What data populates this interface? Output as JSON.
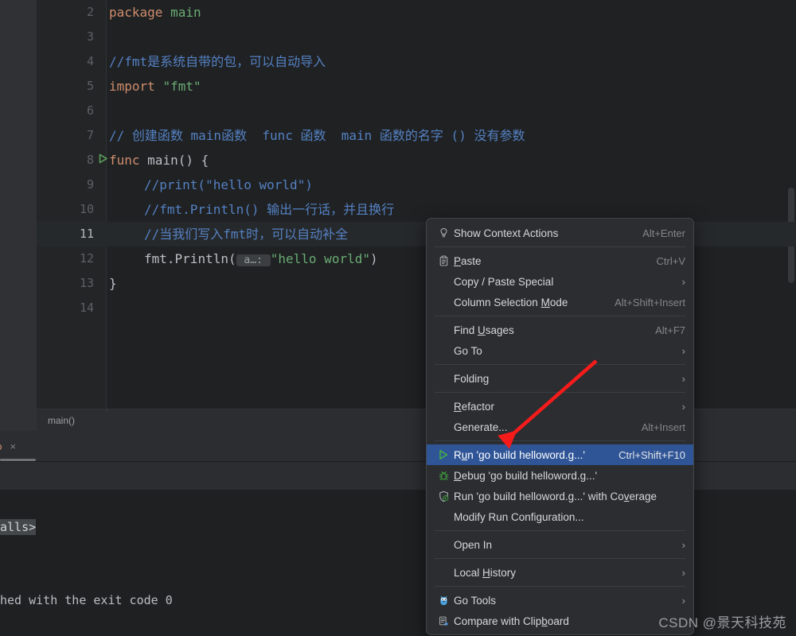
{
  "editor": {
    "lines": [
      {
        "num": "2",
        "indent": 0,
        "tokens": [
          {
            "t": "package ",
            "c": "kw"
          },
          {
            "t": "main",
            "c": "str"
          }
        ]
      },
      {
        "num": "3",
        "indent": 0,
        "tokens": []
      },
      {
        "num": "4",
        "indent": 0,
        "tokens": [
          {
            "t": "//fmt是系统自带的包，可以自动导入",
            "c": "cmt"
          }
        ]
      },
      {
        "num": "5",
        "indent": 0,
        "tokens": [
          {
            "t": "import ",
            "c": "kw"
          },
          {
            "t": "\"fmt\"",
            "c": "str"
          }
        ]
      },
      {
        "num": "6",
        "indent": 0,
        "tokens": []
      },
      {
        "num": "7",
        "indent": 0,
        "tokens": [
          {
            "t": "// 创建函数 main函数  func 函数  main 函数的名字 () 没有参数",
            "c": "cmt"
          }
        ]
      },
      {
        "num": "8",
        "indent": 0,
        "runnable": true,
        "tokens": [
          {
            "t": "func ",
            "c": "kw"
          },
          {
            "t": "main",
            "c": "plain"
          },
          {
            "t": "() {",
            "c": "plain"
          }
        ]
      },
      {
        "num": "9",
        "indent": 1,
        "tokens": [
          {
            "t": "//print(\"hello world\")",
            "c": "cmt"
          }
        ]
      },
      {
        "num": "10",
        "indent": 1,
        "tokens": [
          {
            "t": "//fmt.Println() 输出一行话，并且换行",
            "c": "cmt"
          }
        ]
      },
      {
        "num": "11",
        "indent": 1,
        "current": true,
        "tokens": [
          {
            "t": "//当我们写入fmt时，可以自动补全",
            "c": "cmt"
          }
        ]
      },
      {
        "num": "12",
        "indent": 1,
        "tokens": [
          {
            "t": "fmt",
            "c": "plain"
          },
          {
            "t": ".Println",
            "c": "fn"
          },
          {
            "t": "(",
            "c": "plain"
          },
          {
            "t": " a…: ",
            "c": "paramhint"
          },
          {
            "t": "\"hello world\"",
            "c": "str"
          },
          {
            "t": ")",
            "c": "plain"
          }
        ]
      },
      {
        "num": "13",
        "indent": 0,
        "tokens": [
          {
            "t": "}",
            "c": "plain"
          }
        ]
      },
      {
        "num": "14",
        "indent": 0,
        "tokens": []
      }
    ]
  },
  "breadcrumb": {
    "text": "main()"
  },
  "tool_window": {
    "tab_label": "go",
    "tab_close_glyph": "×",
    "console": {
      "selected_fragment": "alls>",
      "exit_line": "hed with the exit code 0"
    }
  },
  "context_menu": {
    "items": [
      {
        "type": "item",
        "name": "show-context-actions",
        "icon": "lightbulb-icon",
        "label": "Show Context Actions",
        "shortcut": "Alt+Enter"
      },
      {
        "type": "separator"
      },
      {
        "type": "item",
        "name": "paste",
        "icon": "clipboard-icon",
        "label": "Paste",
        "mnemonic": "P",
        "shortcut": "Ctrl+V"
      },
      {
        "type": "item",
        "name": "copy-paste-special",
        "icon": "",
        "label": "Copy / Paste Special",
        "submenu": true
      },
      {
        "type": "item",
        "name": "column-selection-mode",
        "icon": "",
        "label": "Column Selection Mode",
        "mnemonic": "M",
        "shortcut": "Alt+Shift+Insert"
      },
      {
        "type": "separator"
      },
      {
        "type": "item",
        "name": "find-usages",
        "icon": "",
        "label": "Find Usages",
        "mnemonic": "U",
        "shortcut": "Alt+F7"
      },
      {
        "type": "item",
        "name": "go-to",
        "icon": "",
        "label": "Go To",
        "submenu": true
      },
      {
        "type": "separator"
      },
      {
        "type": "item",
        "name": "folding",
        "icon": "",
        "label": "Folding",
        "submenu": true
      },
      {
        "type": "separator"
      },
      {
        "type": "item",
        "name": "refactor",
        "icon": "",
        "label": "Refactor",
        "mnemonic": "R",
        "submenu": true
      },
      {
        "type": "item",
        "name": "generate",
        "icon": "",
        "label": "Generate...",
        "shortcut": "Alt+Insert"
      },
      {
        "type": "separator"
      },
      {
        "type": "item",
        "name": "run-go-build-helloword",
        "icon": "run-play-icon",
        "label": "Run 'go build helloword.g...'",
        "mnemonic": "u",
        "shortcut": "Ctrl+Shift+F10",
        "selected": true
      },
      {
        "type": "item",
        "name": "debug-go-build-helloword",
        "icon": "debug-bug-icon",
        "label": "Debug 'go build helloword.g...'",
        "mnemonic": "D"
      },
      {
        "type": "item",
        "name": "run-with-coverage",
        "icon": "coverage-shield-icon",
        "label": "Run 'go build helloword.g...' with Coverage",
        "mnemonic": "v"
      },
      {
        "type": "item",
        "name": "modify-run-configuration",
        "icon": "",
        "label": "Modify Run Configuration..."
      },
      {
        "type": "separator"
      },
      {
        "type": "item",
        "name": "open-in",
        "icon": "",
        "label": "Open In",
        "submenu": true
      },
      {
        "type": "separator"
      },
      {
        "type": "item",
        "name": "local-history",
        "icon": "",
        "label": "Local History",
        "mnemonic": "H",
        "submenu": true
      },
      {
        "type": "separator"
      },
      {
        "type": "item",
        "name": "go-tools",
        "icon": "gopher-icon",
        "label": "Go Tools",
        "submenu": true
      },
      {
        "type": "item",
        "name": "compare-with-clipboard",
        "icon": "compare-clipboard-icon",
        "label": "Compare with Clipboard",
        "mnemonic": "b"
      }
    ],
    "submenu_glyph": "›"
  },
  "annotation": {
    "arrow_color": "#f51b1b"
  },
  "watermark": {
    "text": "CSDN @景天科技苑"
  },
  "colors": {
    "menu_bg": "#2b2d30",
    "menu_selection": "#2f5597",
    "editor_bg": "#1f2123",
    "gutter_bg": "#232527",
    "comment": "#5581c2",
    "keyword": "#cf8e6d",
    "string": "#6aab73",
    "run_green": "#5a9e5a"
  }
}
